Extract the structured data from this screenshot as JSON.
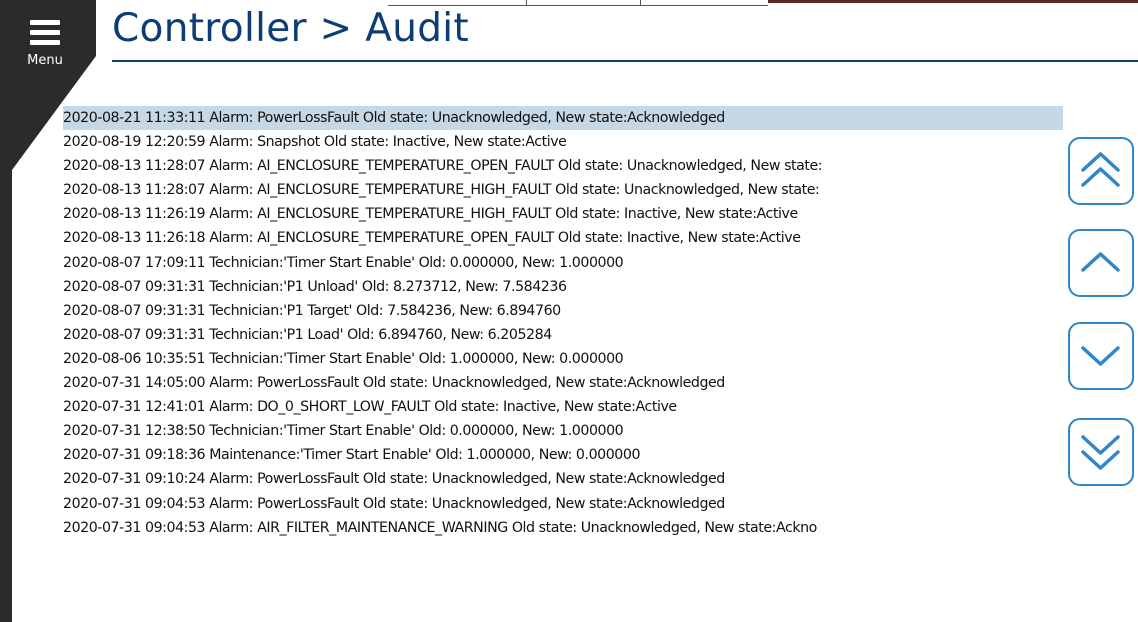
{
  "header": {
    "title": "Controller > Audit"
  },
  "menu": {
    "label": "Menu",
    "icon": "hamburger-icon"
  },
  "colors": {
    "rail": "#2b2b2b",
    "title": "#0e3d75",
    "selected_row": "#c6d7e5",
    "button_border": "#2f86c8"
  },
  "audit": {
    "selected_index": 0,
    "rows": [
      "2020-08-21 11:33:11 Alarm: PowerLossFault Old state: Unacknowledged, New state:Acknowledged",
      "2020-08-19 12:20:59 Alarm: Snapshot Old state: Inactive, New state:Active",
      "2020-08-13 11:28:07 Alarm: AI_ENCLOSURE_TEMPERATURE_OPEN_FAULT Old state: Unacknowledged, New state:",
      "2020-08-13 11:28:07 Alarm: AI_ENCLOSURE_TEMPERATURE_HIGH_FAULT Old state: Unacknowledged, New state:",
      "2020-08-13 11:26:19 Alarm: AI_ENCLOSURE_TEMPERATURE_HIGH_FAULT Old state: Inactive, New state:Active",
      "2020-08-13 11:26:18 Alarm: AI_ENCLOSURE_TEMPERATURE_OPEN_FAULT Old state: Inactive, New state:Active",
      "2020-08-07 17:09:11 Technician:'Timer Start Enable' Old: 0.000000, New: 1.000000",
      "2020-08-07 09:31:31 Technician:'P1 Unload' Old: 8.273712, New: 7.584236",
      "2020-08-07 09:31:31 Technician:'P1 Target' Old: 7.584236, New: 6.894760",
      "2020-08-07 09:31:31 Technician:'P1 Load' Old: 6.894760, New: 6.205284",
      "2020-08-06 10:35:51 Technician:'Timer Start Enable' Old: 1.000000, New: 0.000000",
      "2020-07-31 14:05:00 Alarm: PowerLossFault Old state: Unacknowledged, New state:Acknowledged",
      "2020-07-31 12:41:01 Alarm: DO_0_SHORT_LOW_FAULT Old state: Inactive, New state:Active",
      "2020-07-31 12:38:50 Technician:'Timer Start Enable' Old: 0.000000, New: 1.000000",
      "2020-07-31 09:18:36 Maintenance:'Timer Start Enable' Old: 1.000000, New: 0.000000",
      "2020-07-31 09:10:24 Alarm: PowerLossFault Old state: Unacknowledged, New state:Acknowledged",
      "2020-07-31 09:04:53 Alarm: PowerLossFault Old state: Unacknowledged, New state:Acknowledged",
      "2020-07-31 09:04:53 Alarm: AIR_FILTER_MAINTENANCE_WARNING Old state: Unacknowledged, New state:Ackno"
    ]
  },
  "scroll_buttons": [
    {
      "name": "page-up-button",
      "icon": "double-chevron-up-icon"
    },
    {
      "name": "line-up-button",
      "icon": "chevron-up-icon"
    },
    {
      "name": "line-down-button",
      "icon": "chevron-down-icon"
    },
    {
      "name": "page-down-button",
      "icon": "double-chevron-down-icon"
    }
  ]
}
